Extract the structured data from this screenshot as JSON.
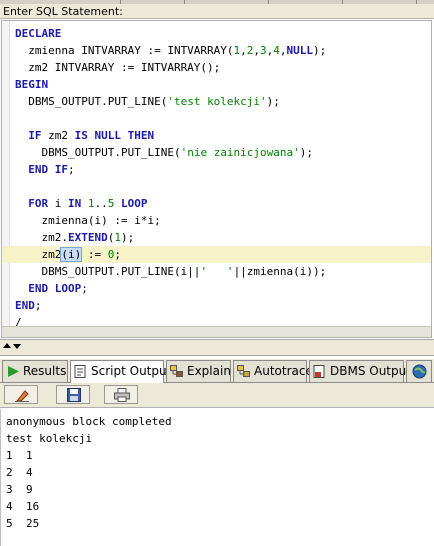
{
  "editor": {
    "label": "Enter SQL Statement:",
    "lines": [
      "DECLARE",
      "  zmienna INTVARRAY := INTVARRAY(1,2,3,4,NULL);",
      "  zm2 INTVARRAY := INTVARRAY();",
      "BEGIN",
      "  DBMS_OUTPUT.PUT_LINE('test kolekcji');",
      "",
      "  IF zm2 IS NULL THEN",
      "    DBMS_OUTPUT.PUT_LINE('nie zainicjowana');",
      "  END IF;",
      "",
      "  FOR i IN 1..5 LOOP",
      "    zmienna(i) := i*i;",
      "    zm2.EXTEND(1);",
      "    zm2(i) := 0;",
      "    DBMS_OUTPUT.PUT_LINE(i||'   '||zmienna(i));",
      "  END LOOP;",
      "END;",
      "/"
    ],
    "current_line": 13
  },
  "tabs": [
    {
      "label": "Results",
      "icon": "run-arrow-icon"
    },
    {
      "label": "Script Output",
      "icon": "script-output-icon",
      "active": true
    },
    {
      "label": "Explain",
      "icon": "explain-plan-icon"
    },
    {
      "label": "Autotrace",
      "icon": "autotrace-icon"
    },
    {
      "label": "DBMS Output",
      "icon": "dbms-output-icon"
    }
  ],
  "toolbar": {
    "buttons": [
      "eraser-icon",
      "save-disk-icon",
      "print-icon"
    ]
  },
  "output": {
    "header_lines": [
      "anonymous block completed",
      "test kolekcji"
    ],
    "rows": [
      {
        "i": "1",
        "value": "1"
      },
      {
        "i": "2",
        "value": "4"
      },
      {
        "i": "3",
        "value": "9"
      },
      {
        "i": "4",
        "value": "16"
      },
      {
        "i": "5",
        "value": "25"
      }
    ]
  },
  "colors": {
    "keyword": "#1a1aa6",
    "literal": "#008000",
    "current_line": "#f7f3c8",
    "panel_bg": "#ece9d8"
  }
}
